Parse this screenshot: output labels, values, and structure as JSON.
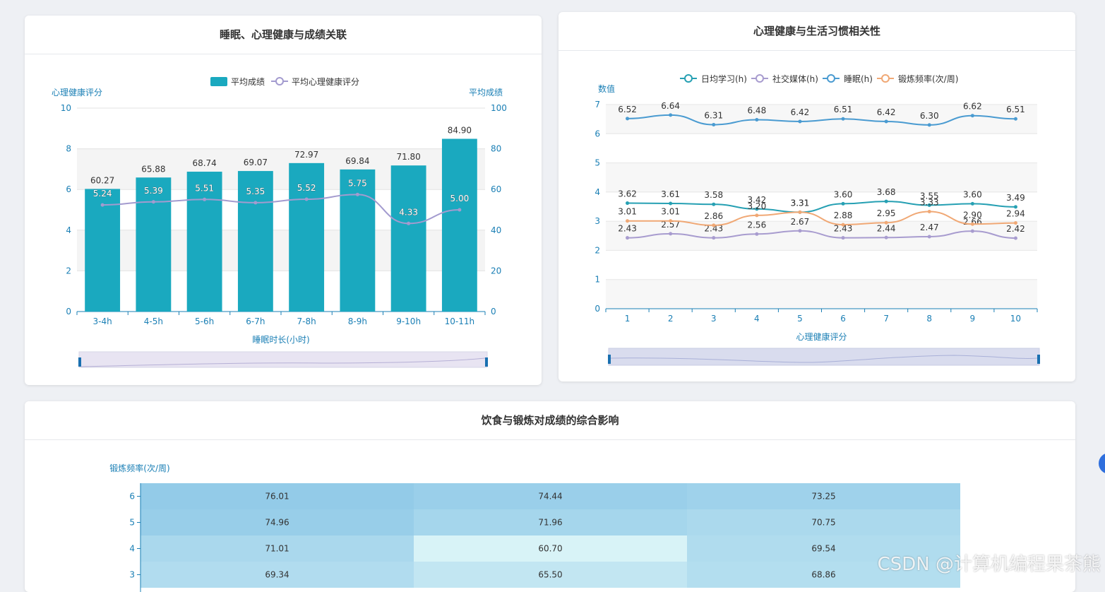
{
  "watermark": "CSDN @计算机编程果茶熊",
  "colors": {
    "bar": "#1aa9bf",
    "mental_line": "#a39bcf",
    "axis": "#1a7fb5"
  },
  "chart_data": [
    {
      "type": "bar",
      "title": "睡眠、心理健康与成绩关联",
      "xlabel": "睡眠时长(小时)",
      "ylabel_left": "心理健康评分",
      "ylabel_right": "平均成绩",
      "categories": [
        "3-4h",
        "4-5h",
        "5-6h",
        "6-7h",
        "7-8h",
        "8-9h",
        "9-10h",
        "10-11h"
      ],
      "y_left_lim": [
        0,
        10
      ],
      "y_left_ticks": [
        "0",
        "2",
        "4",
        "6",
        "8",
        "10"
      ],
      "y_right_lim": [
        0,
        100
      ],
      "y_right_ticks": [
        "0",
        "20",
        "40",
        "60",
        "80",
        "100"
      ],
      "legend_position": "top",
      "series": [
        {
          "name": "平均成绩",
          "type": "bar",
          "axis": "right",
          "values": [
            60.27,
            65.88,
            68.74,
            69.07,
            72.97,
            69.84,
            71.8,
            84.9
          ],
          "labels": [
            "60.27",
            "65.88",
            "68.74",
            "69.07",
            "72.97",
            "69.84",
            "71.80",
            "84.90"
          ]
        },
        {
          "name": "平均心理健康评分",
          "type": "line",
          "axis": "left",
          "values": [
            5.24,
            5.39,
            5.51,
            5.35,
            5.52,
            5.75,
            4.33,
            5.0
          ],
          "labels": [
            "5.24",
            "5.39",
            "5.51",
            "5.35",
            "5.52",
            "5.75",
            "4.33",
            "5.00"
          ]
        }
      ]
    },
    {
      "type": "line",
      "title": "心理健康与生活习惯相关性",
      "xlabel": "心理健康评分",
      "ylabel": "数值",
      "categories": [
        "1",
        "2",
        "3",
        "4",
        "5",
        "6",
        "7",
        "8",
        "9",
        "10"
      ],
      "ylim": [
        0,
        7
      ],
      "y_ticks": [
        "0",
        "1",
        "2",
        "3",
        "4",
        "5",
        "6",
        "7"
      ],
      "legend_position": "top",
      "series": [
        {
          "name": "日均学习(h)",
          "color": "#26a0b3",
          "values": [
            3.62,
            3.61,
            3.58,
            3.42,
            3.31,
            3.6,
            3.68,
            3.55,
            3.6,
            3.49
          ],
          "labels": [
            "3.62",
            "3.61",
            "3.58",
            "3.42",
            "3.31",
            "3.60",
            "3.68",
            "3.55",
            "3.60",
            "3.49"
          ]
        },
        {
          "name": "社交媒体(h)",
          "color": "#a89ccf",
          "values": [
            2.43,
            2.57,
            2.43,
            2.56,
            2.67,
            2.43,
            2.44,
            2.47,
            2.66,
            2.42
          ],
          "labels": [
            "2.43",
            "2.57",
            "2.43",
            "2.56",
            "2.67",
            "2.43",
            "2.44",
            "2.47",
            "2.66",
            "2.42"
          ]
        },
        {
          "name": "睡眠(h)",
          "color": "#4a9bd1",
          "values": [
            6.52,
            6.64,
            6.31,
            6.48,
            6.42,
            6.51,
            6.42,
            6.3,
            6.62,
            6.51
          ],
          "labels": [
            "6.52",
            "6.64",
            "6.31",
            "6.48",
            "6.42",
            "6.51",
            "6.42",
            "6.30",
            "6.62",
            "6.51"
          ]
        },
        {
          "name": "锻炼频率(次/周)",
          "color": "#f0a875",
          "values": [
            3.01,
            3.01,
            2.86,
            3.2,
            3.31,
            2.88,
            2.95,
            3.33,
            2.9,
            2.94
          ],
          "labels": [
            "3.01",
            "3.01",
            "2.86",
            "3.20",
            "3.31",
            "2.88",
            "2.95",
            "3.33",
            "2.90",
            "2.94"
          ]
        }
      ]
    },
    {
      "type": "heatmap",
      "title": "饮食与锻炼对成绩的综合影响",
      "ylabel": "锻炼频率(次/周)",
      "rows": [
        "6",
        "5",
        "4",
        "3"
      ],
      "values": [
        [
          76.01,
          74.44,
          73.25
        ],
        [
          74.96,
          71.96,
          70.75
        ],
        [
          71.01,
          60.7,
          69.54
        ],
        [
          69.34,
          65.5,
          68.86
        ]
      ],
      "labels": [
        [
          "76.01",
          "74.44",
          "73.25"
        ],
        [
          "74.96",
          "71.96",
          "70.75"
        ],
        [
          "71.01",
          "60.70",
          "69.54"
        ],
        [
          "69.34",
          "65.50",
          "68.86"
        ]
      ],
      "color_range": [
        "#d8f3f7",
        "#93cbe8"
      ]
    }
  ]
}
